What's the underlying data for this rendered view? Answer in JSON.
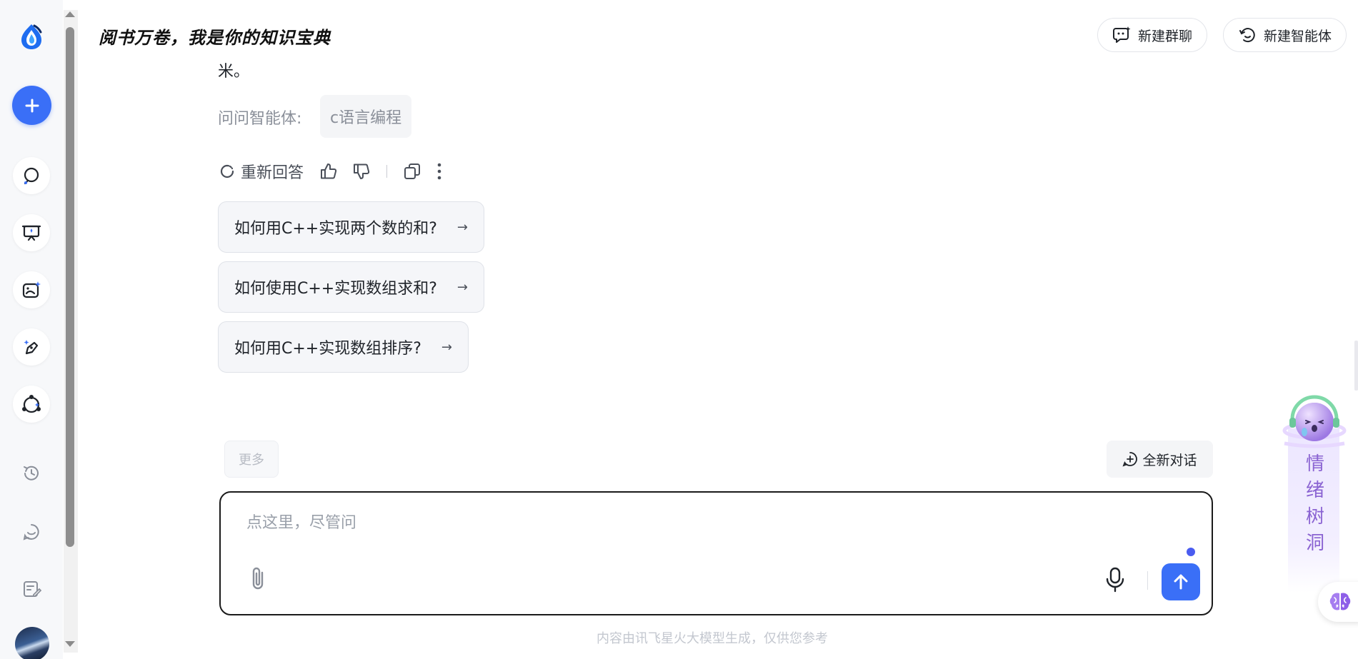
{
  "header": {
    "title": "阅书万卷，我是你的知识宝典",
    "new_group_chat": "新建群聊",
    "new_agent": "新建智能体"
  },
  "sidebar": {
    "items": [
      {
        "icon": "chat-search-icon"
      },
      {
        "icon": "presentation-icon"
      },
      {
        "icon": "image-gen-icon"
      },
      {
        "icon": "pen-sparkle-icon"
      },
      {
        "icon": "agent-network-icon"
      },
      {
        "icon": "history-icon"
      },
      {
        "icon": "smile-chat-icon"
      },
      {
        "icon": "notes-edit-icon"
      }
    ]
  },
  "conversation": {
    "truncated_text": "米。",
    "ask_agent_label": "问问智能体:",
    "ask_agent_chip": "c语言编程",
    "regenerate_label": "重新回答",
    "suggestions": [
      "如何用C++实现两个数的和?",
      "如何使用C++实现数组求和?",
      "如何用C++实现数组排序?"
    ],
    "suggestion_arrow": "→"
  },
  "composer": {
    "more_label": "更多",
    "new_conversation": "全新对话",
    "placeholder": "点这里，尽管问",
    "footnote": "内容由讯飞星火大模型生成，仅供您参考"
  },
  "floating": {
    "tree_hole": [
      "情",
      "绪",
      "树",
      "洞"
    ]
  },
  "colors": {
    "accent": "#3a6ff7",
    "purple_text": "#8a63d2"
  }
}
